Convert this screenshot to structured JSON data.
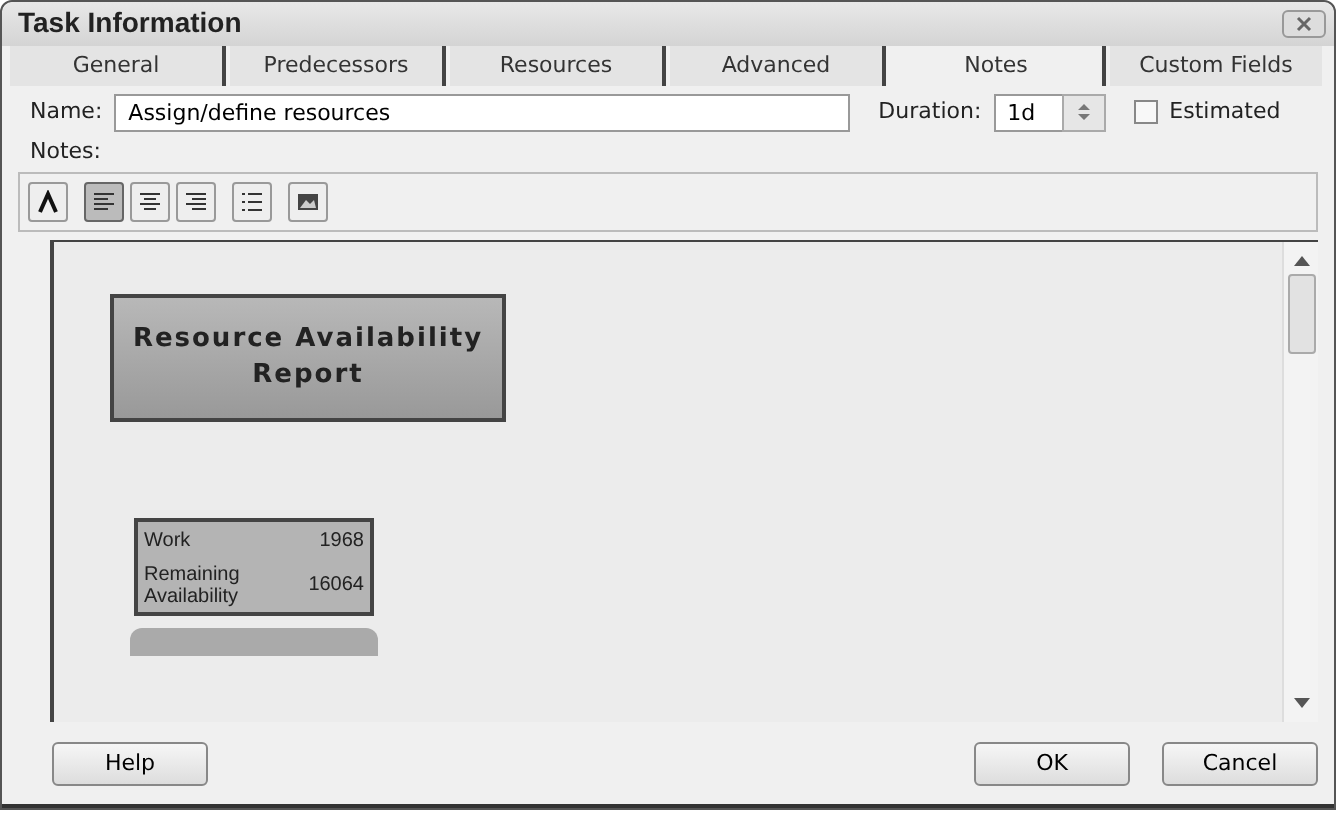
{
  "window": {
    "title": "Task Information"
  },
  "tabs": [
    {
      "label": "General",
      "selected": false
    },
    {
      "label": "Predecessors",
      "selected": false
    },
    {
      "label": "Resources",
      "selected": false
    },
    {
      "label": "Advanced",
      "selected": false
    },
    {
      "label": "Notes",
      "selected": true
    },
    {
      "label": "Custom Fields",
      "selected": false
    }
  ],
  "name_field": {
    "label": "Name:",
    "value": "Assign/define resources"
  },
  "duration_field": {
    "label": "Duration:",
    "value": "1d"
  },
  "estimated": {
    "label": "Estimated",
    "checked": false
  },
  "notes_label": "Notes:",
  "toolbar": [
    {
      "kind": "font",
      "pressed": false
    },
    {
      "kind": "align-left",
      "pressed": true
    },
    {
      "kind": "align-center",
      "pressed": false
    },
    {
      "kind": "align-right",
      "pressed": false
    },
    {
      "kind": "bullets",
      "pressed": false
    },
    {
      "kind": "picture",
      "pressed": false
    }
  ],
  "report": {
    "title": "Resource Availability Report",
    "rows": [
      {
        "label": "Work",
        "value": "1968"
      },
      {
        "label": "Remaining Availability",
        "value": "16064"
      }
    ]
  },
  "buttons": {
    "help": "Help",
    "ok": "OK",
    "cancel": "Cancel"
  }
}
